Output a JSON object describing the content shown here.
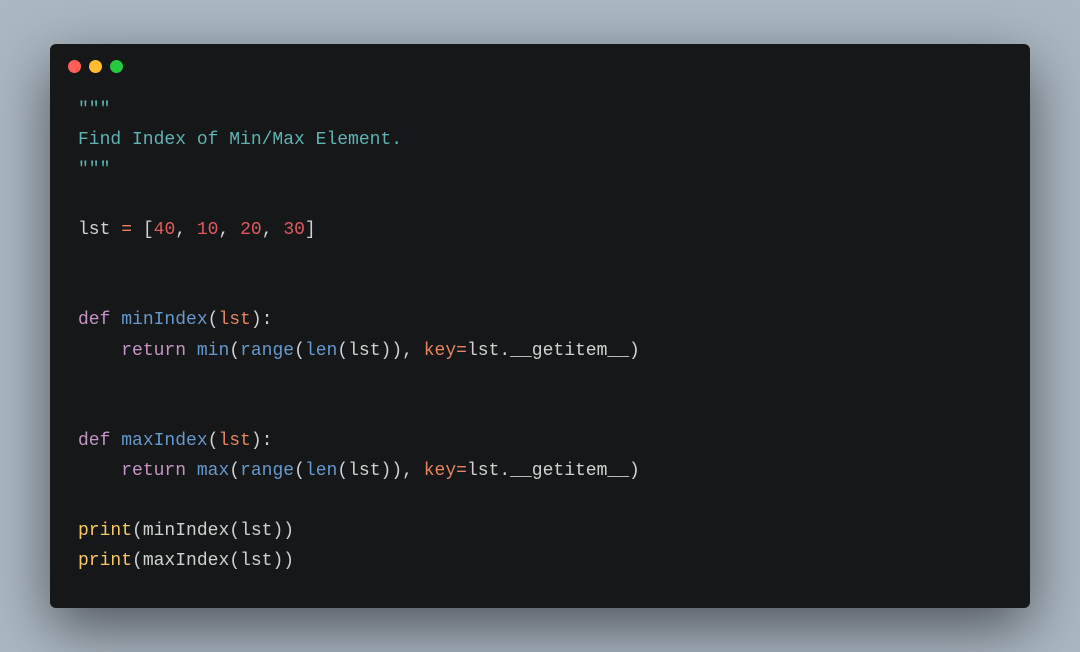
{
  "window": {
    "buttons": {
      "close": "close",
      "minimize": "minimize",
      "zoom": "zoom"
    }
  },
  "code": {
    "docstring_open": "\"\"\"",
    "docstring_text": "Find Index of Min/Max Element.",
    "docstring_close": "\"\"\"",
    "lst_name": "lst",
    "assign_op": "=",
    "lbrack": "[",
    "rbrack": "]",
    "comma": ", ",
    "nums": [
      "40",
      "10",
      "20",
      "30"
    ],
    "def_kw": "def",
    "return_kw": "return",
    "min_func_name": "minIndex",
    "max_func_name": "maxIndex",
    "param": "lst",
    "lparen": "(",
    "rparen": ")",
    "colon": ":",
    "min_builtin": "min",
    "max_builtin": "max",
    "range_builtin": "range",
    "len_builtin": "len",
    "key_kw": "key",
    "eq": "=",
    "dot": ".",
    "getitem": "__getitem__",
    "print_builtin": "print",
    "indent": "    "
  }
}
